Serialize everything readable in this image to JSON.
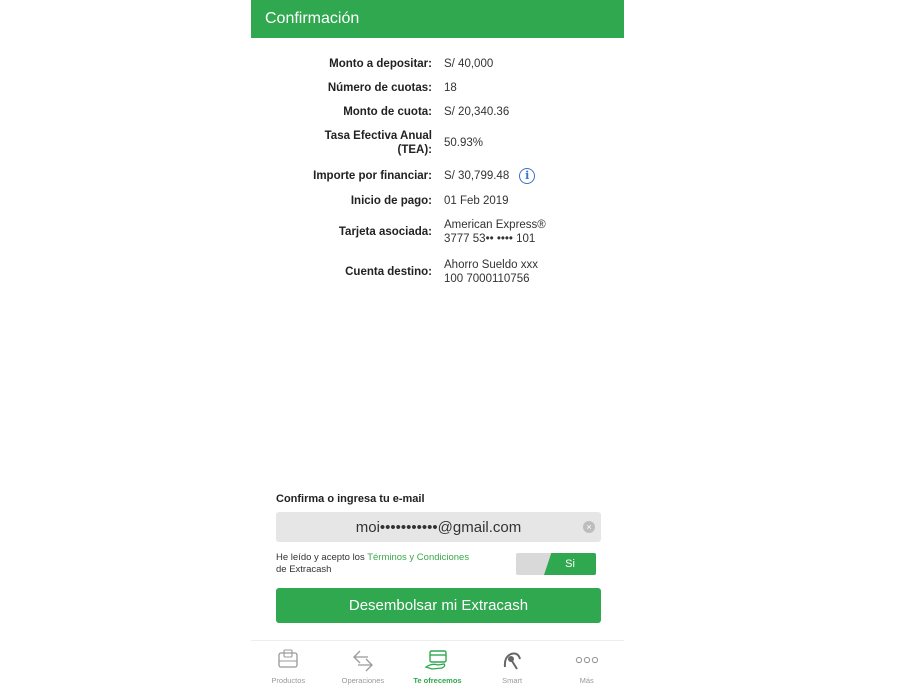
{
  "header": {
    "title": "Confirmación"
  },
  "details": [
    {
      "label": "Monto a depositar:",
      "value": "S/ 40,000"
    },
    {
      "label": "Número de cuotas:",
      "value": "18"
    },
    {
      "label": "Monto de cuota:",
      "value": "S/ 20,340.36"
    },
    {
      "label_line1": "Tasa Efectiva Anual",
      "label_line2": "(TEA):",
      "value": "50.93%"
    },
    {
      "label": "Importe por financiar:",
      "value": "S/ 30,799.48",
      "info_icon": "info-icon"
    },
    {
      "label": "Inicio de pago:",
      "value": "01 Feb 2019"
    },
    {
      "label": "Tarjeta asociada:",
      "value_line1": "American Express®",
      "value_line2": "3777 53•• •••• 101"
    },
    {
      "label": "Cuenta destino:",
      "value_line1": "Ahorro Sueldo xxx",
      "value_line2": "100 7000110756"
    }
  ],
  "email": {
    "label": "Confirma o ingresa tu e-mail",
    "value": "moi•••••••••••@gmail.com",
    "clear_icon": "×"
  },
  "terms": {
    "prefix": "He leído y acepto los ",
    "link": "Términos y Condiciones",
    "suffix": "de Extracash",
    "toggle_label": "Si"
  },
  "cta": {
    "label": "Desembolsar mi Extracash"
  },
  "tabs": [
    {
      "label": "Productos",
      "icon": "wallet-icon"
    },
    {
      "label": "Operaciones",
      "icon": "transfer-arrows-icon"
    },
    {
      "label": "Te ofrecemos",
      "icon": "card-hand-icon",
      "active": true
    },
    {
      "label": "Smart",
      "icon": "smart-hand-icon"
    },
    {
      "label": "Más",
      "icon": "more-dots-icon"
    }
  ],
  "colors": {
    "brand": "#2fa84f",
    "link": "#3aa84a",
    "info": "#3b73c9"
  }
}
